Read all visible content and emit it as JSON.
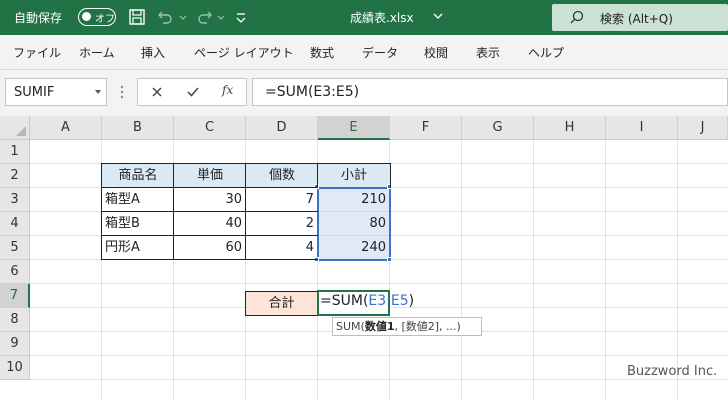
{
  "titlebar": {
    "autosave_label": "自動保存",
    "autosave_toggle": "オフ",
    "file_title": "成績表.xlsx",
    "search_label": "検索 (Alt+Q)"
  },
  "ribbon": {
    "tabs": [
      "ファイル",
      "ホーム",
      "挿入",
      "ページ レイアウト",
      "数式",
      "データ",
      "校閲",
      "表示",
      "ヘルプ"
    ]
  },
  "formula_bar": {
    "name_box": "SUMIF",
    "fx_label": "fx",
    "formula": "=SUM(E3:E5)"
  },
  "columns": [
    "A",
    "B",
    "C",
    "D",
    "E",
    "F",
    "G",
    "H",
    "I",
    "J"
  ],
  "rows": [
    "1",
    "2",
    "3",
    "4",
    "5",
    "6",
    "7",
    "8",
    "9",
    "10"
  ],
  "table": {
    "headers": [
      "商品名",
      "単価",
      "個数",
      "小計"
    ],
    "rows": [
      [
        "箱型A",
        "30",
        "7",
        "210"
      ],
      [
        "箱型B",
        "40",
        "2",
        "80"
      ],
      [
        "円形A",
        "60",
        "4",
        "240"
      ]
    ]
  },
  "total": {
    "label": "合計",
    "formula_prefix": "=SUM(",
    "formula_ref": "E3:E5",
    "formula_suffix": ")"
  },
  "tooltip": {
    "prefix": "SUM(",
    "arg_bold": "数値1",
    "rest": ", [数値2], ...)"
  },
  "watermark": "Buzzword Inc.",
  "colors": {
    "excel_green": "#217346",
    "header_fill": "#dbe9f5",
    "total_fill": "#fce4d6",
    "range_blue": "#3a73c4"
  }
}
